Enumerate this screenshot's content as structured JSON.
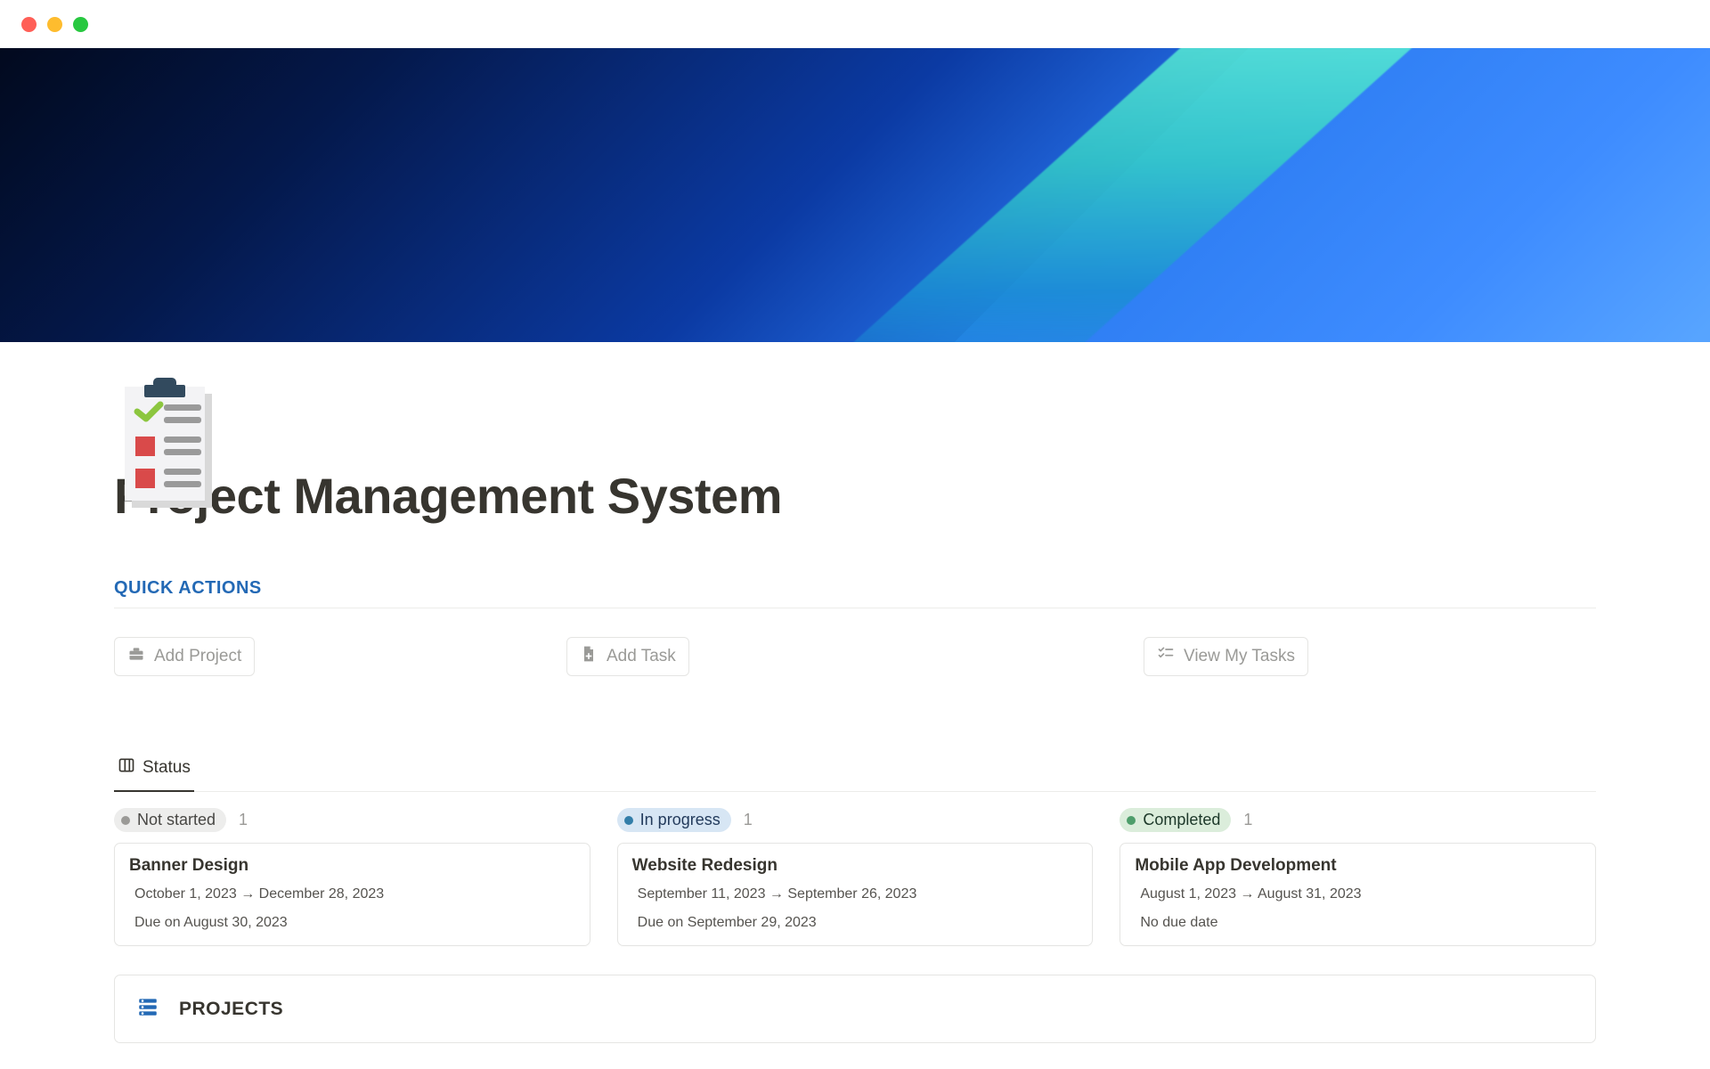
{
  "header": {
    "title": "Project Management System"
  },
  "quick_actions": {
    "heading": "QUICK ACTIONS",
    "add_project": "Add Project",
    "add_task": "Add Task",
    "view_my_tasks": "View My Tasks"
  },
  "tabs": {
    "status": "Status"
  },
  "board": {
    "columns": [
      {
        "status_label": "Not started",
        "count": "1",
        "pill_class": "pill-gray",
        "card": {
          "title": "Banner Design",
          "date_range": "October 1, 2023 → December 28, 2023",
          "due": "Due on August 30, 2023"
        }
      },
      {
        "status_label": "In progress",
        "count": "1",
        "pill_class": "pill-blue",
        "card": {
          "title": "Website Redesign",
          "date_range": "September 11, 2023 → September 26, 2023",
          "due": "Due on September 29, 2023"
        }
      },
      {
        "status_label": "Completed",
        "count": "1",
        "pill_class": "pill-green",
        "card": {
          "title": "Mobile App Development",
          "date_range": "August 1, 2023 → August 31, 2023",
          "due": "No due date"
        }
      }
    ]
  },
  "projects": {
    "heading": "PROJECTS"
  },
  "colors": {
    "accent_blue": "#2369b5"
  }
}
